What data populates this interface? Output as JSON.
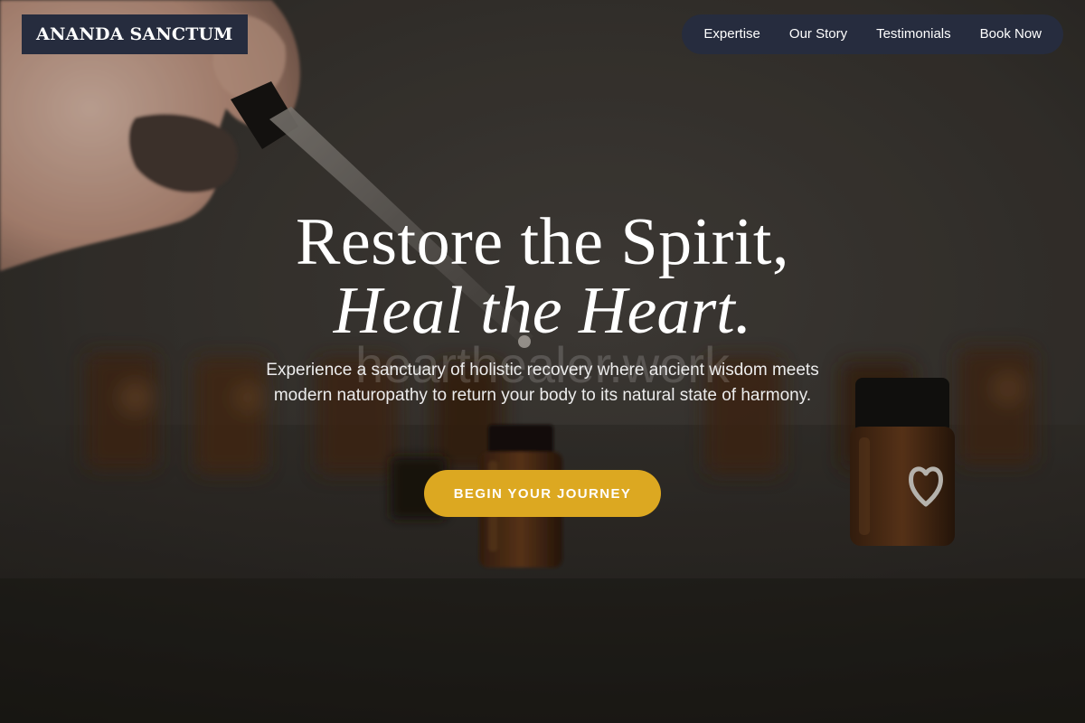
{
  "brand": {
    "name": "ANANDA SANCTUM"
  },
  "nav": {
    "items": [
      {
        "label": "Expertise"
      },
      {
        "label": "Our Story"
      },
      {
        "label": "Testimonials"
      },
      {
        "label": "Book Now"
      }
    ]
  },
  "hero": {
    "headline_line1": "Restore the Spirit,",
    "headline_line2": "Heal the Heart.",
    "watermark": "hearthealer.work",
    "subtext": "Experience a sanctuary of holistic recovery where ancient wisdom meets modern naturopathy to return your body to its natural state of harmony.",
    "cta_label": "BEGIN YOUR JOURNEY"
  },
  "colors": {
    "nav_bg": "#262c3e",
    "accent": "#dca821",
    "text_light": "#ffffff"
  },
  "icons": {
    "bottle_label": "heart-icon"
  }
}
